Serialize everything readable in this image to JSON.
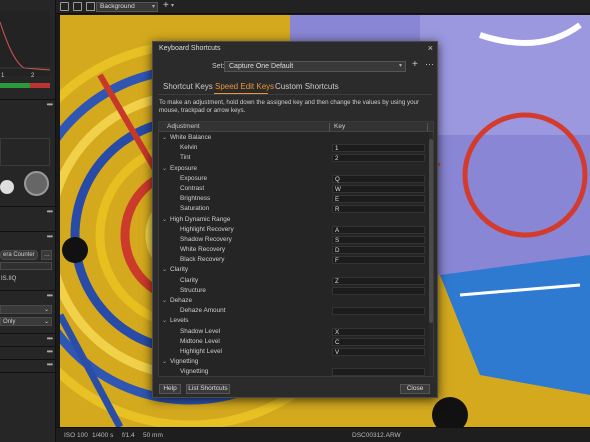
{
  "toolbar": {
    "view_select": "Background",
    "add_label": "+"
  },
  "left_panel": {
    "curve_labels": [
      "1",
      "2"
    ],
    "camera_counter": "era Counter",
    "filename_field": "IS.IIQ",
    "only_select": "Only",
    "dots": "•••"
  },
  "bottom_bar": {
    "iso": "ISO 100",
    "shutter": "1/400 s",
    "aperture": "f/1.4",
    "focal": "50 mm",
    "filename": "DSC00312.ARW"
  },
  "dialog": {
    "title": "Keyboard Shortcuts",
    "close_glyph": "×",
    "set_label": "Set:",
    "set_value": "Capture One Default",
    "add_glyph": "+",
    "more_glyph": "···",
    "tabs": [
      {
        "label": "Shortcut Keys",
        "active": false
      },
      {
        "label": "Speed Edit Keys",
        "active": true
      },
      {
        "label": "Custom Shortcuts",
        "active": false
      }
    ],
    "instructions": "To make an adjustment, hold down the assigned key and then change the values by using your mouse, trackpad or arrow keys.",
    "table": {
      "col_adjustment": "Adjustment",
      "col_key": "Key",
      "rows": [
        {
          "kind": "group",
          "name": "White Balance"
        },
        {
          "kind": "item",
          "name": "Kelvin",
          "key": "1"
        },
        {
          "kind": "item",
          "name": "Tint",
          "key": "2"
        },
        {
          "kind": "group",
          "name": "Exposure"
        },
        {
          "kind": "item",
          "name": "Exposure",
          "key": "Q"
        },
        {
          "kind": "item",
          "name": "Contrast",
          "key": "W"
        },
        {
          "kind": "item",
          "name": "Brightness",
          "key": "E"
        },
        {
          "kind": "item",
          "name": "Saturation",
          "key": "R"
        },
        {
          "kind": "group",
          "name": "High Dynamic Range"
        },
        {
          "kind": "item",
          "name": "Highlight Recovery",
          "key": "A"
        },
        {
          "kind": "item",
          "name": "Shadow Recovery",
          "key": "S"
        },
        {
          "kind": "item",
          "name": "White Recovery",
          "key": "D"
        },
        {
          "kind": "item",
          "name": "Black Recovery",
          "key": "F"
        },
        {
          "kind": "group",
          "name": "Clarity"
        },
        {
          "kind": "item",
          "name": "Clarity",
          "key": "Z"
        },
        {
          "kind": "item",
          "name": "Structure",
          "key": ""
        },
        {
          "kind": "group",
          "name": "Dehaze"
        },
        {
          "kind": "item",
          "name": "Dehaze Amount",
          "key": ""
        },
        {
          "kind": "group",
          "name": "Levels"
        },
        {
          "kind": "item",
          "name": "Shadow Level",
          "key": "X"
        },
        {
          "kind": "item",
          "name": "Midtone Level",
          "key": "C"
        },
        {
          "kind": "item",
          "name": "Highlight Level",
          "key": "V"
        },
        {
          "kind": "group",
          "name": "Vignetting"
        },
        {
          "kind": "item",
          "name": "Vignetting",
          "key": ""
        }
      ]
    },
    "buttons": {
      "help": "Help",
      "list": "List Shortcuts",
      "close": "Close"
    }
  },
  "colors": {
    "accent": "#e7963b",
    "dialog_bg": "#2b2b2b",
    "panel_bg": "#262626"
  }
}
